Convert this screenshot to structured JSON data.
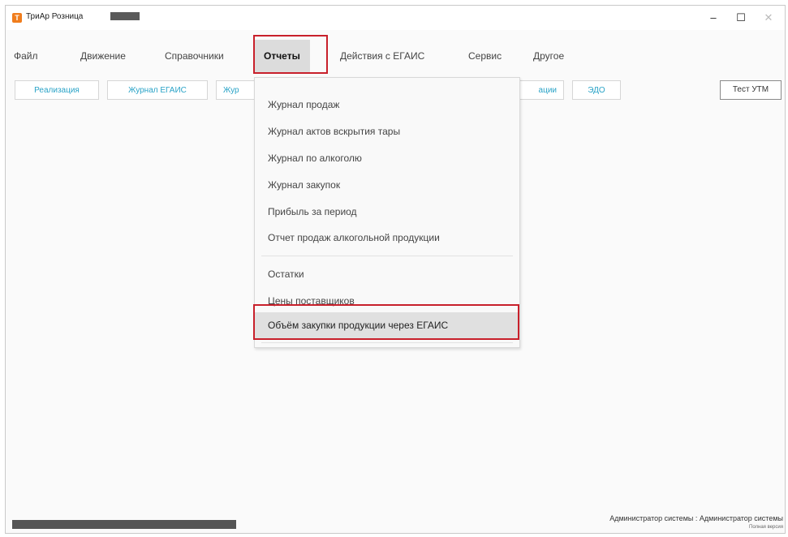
{
  "window": {
    "title": "ТриАр Розница",
    "minimize": "–",
    "maximize": "☐",
    "close": "✕"
  },
  "menu": {
    "items": [
      {
        "label": "Файл"
      },
      {
        "label": "Движение"
      },
      {
        "label": "Справочники"
      },
      {
        "label": "Отчеты"
      },
      {
        "label": "Действия с ЕГАИС"
      },
      {
        "label": "Сервис"
      },
      {
        "label": "Другое"
      }
    ],
    "active": "Отчеты"
  },
  "tabs": [
    {
      "label": "Реализация"
    },
    {
      "label": "Журнал ЕГАИС"
    },
    {
      "label": "Жур"
    },
    {
      "label": "ации"
    },
    {
      "label": "ЭДО"
    }
  ],
  "test_utm_label": "Тест УТМ",
  "dropdown": {
    "items": [
      {
        "label": "Журнал продаж"
      },
      {
        "label": "Журнал актов вскрытия тары"
      },
      {
        "label": "Журнал по алкоголю"
      },
      {
        "label": "Журнал закупок"
      },
      {
        "label": "Прибыль за период"
      },
      {
        "label": "Отчет продаж алкогольной продукции"
      },
      {
        "label": "Остатки"
      },
      {
        "label": "Цены поставщиков"
      },
      {
        "label": "Объём закупки продукции через ЕГАИС"
      }
    ],
    "selected": "Объём закупки продукции через ЕГАИС"
  },
  "status": {
    "user": "Администратор системы : Администратор системы",
    "version": "Полная версия"
  },
  "colors": {
    "highlight": "#c8202b",
    "tab_text": "#2aa3c7",
    "app_icon": "#f07d1d"
  }
}
